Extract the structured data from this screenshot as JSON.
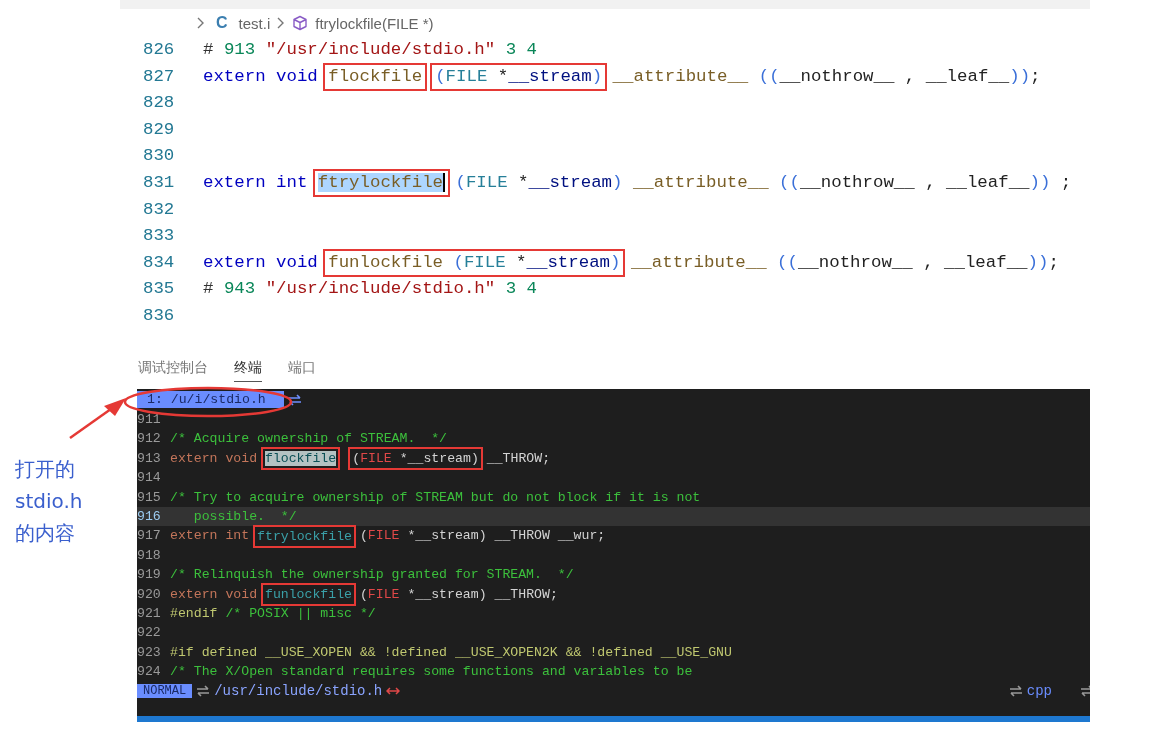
{
  "breadcrumb": {
    "file_badge": "C",
    "file": "test.i",
    "symbol": "ftrylockfile(FILE *)"
  },
  "editor": {
    "lines": [
      {
        "number": "826",
        "tokens": [
          {
            "kind": "preproc",
            "text": "# "
          },
          {
            "kind": "number",
            "text": "913 "
          },
          {
            "kind": "string",
            "text": "\"/usr/include/stdio.h\""
          },
          {
            "kind": "number",
            "text": " 3 4"
          }
        ]
      },
      {
        "number": "827",
        "tokens": [
          {
            "kind": "keyword",
            "text": "extern void "
          },
          {
            "kind": "box",
            "tokens": [
              {
                "kind": "func",
                "text": "flockfile"
              }
            ]
          },
          {
            "kind": "box",
            "tokens": [
              {
                "kind": "paren",
                "text": "("
              },
              {
                "kind": "type",
                "text": "FILE"
              },
              {
                "kind": "plain",
                "text": " *"
              },
              {
                "kind": "param",
                "text": "__stream"
              },
              {
                "kind": "paren",
                "text": ")"
              }
            ]
          },
          {
            "kind": "attr",
            "text": " __attribute__"
          },
          {
            "kind": "paren",
            "text": " (("
          },
          {
            "kind": "plain",
            "text": "__nothrow__ , __leaf__"
          },
          {
            "kind": "paren",
            "text": "))"
          },
          {
            "kind": "plain",
            "text": ";"
          }
        ]
      },
      {
        "number": "828"
      },
      {
        "number": "829"
      },
      {
        "number": "830"
      },
      {
        "number": "831",
        "tokens": [
          {
            "kind": "keyword",
            "text": "extern int "
          },
          {
            "kind": "box",
            "tokens": [
              {
                "kind": "selection",
                "text": "ftrylockfile"
              }
            ]
          },
          {
            "kind": "paren",
            "text": " ("
          },
          {
            "kind": "type",
            "text": "FILE"
          },
          {
            "kind": "plain",
            "text": " *"
          },
          {
            "kind": "param",
            "text": "__stream"
          },
          {
            "kind": "paren",
            "text": ")"
          },
          {
            "kind": "attr",
            "text": " __attribute__"
          },
          {
            "kind": "paren",
            "text": " (("
          },
          {
            "kind": "plain",
            "text": "__nothrow__ , __leaf__"
          },
          {
            "kind": "paren",
            "text": "))"
          },
          {
            "kind": "plain",
            "text": " ;"
          }
        ]
      },
      {
        "number": "832"
      },
      {
        "number": "833"
      },
      {
        "number": "834",
        "tokens": [
          {
            "kind": "keyword",
            "text": "extern void "
          },
          {
            "kind": "box",
            "tokens": [
              {
                "kind": "func",
                "text": "funlockfile"
              },
              {
                "kind": "paren",
                "text": " ("
              },
              {
                "kind": "type",
                "text": "FILE"
              },
              {
                "kind": "plain",
                "text": " *"
              },
              {
                "kind": "param",
                "text": "__stream"
              },
              {
                "kind": "paren",
                "text": ")"
              }
            ]
          },
          {
            "kind": "attr",
            "text": " __attribute__"
          },
          {
            "kind": "paren",
            "text": " (("
          },
          {
            "kind": "plain",
            "text": "__nothrow__ , __leaf__"
          },
          {
            "kind": "paren",
            "text": "))"
          },
          {
            "kind": "plain",
            "text": ";"
          }
        ]
      },
      {
        "number": "835",
        "tokens": [
          {
            "kind": "preproc",
            "text": "# "
          },
          {
            "kind": "number",
            "text": "943 "
          },
          {
            "kind": "string",
            "text": "\"/usr/include/stdio.h\""
          },
          {
            "kind": "number",
            "text": " 3 4"
          }
        ]
      },
      {
        "number": "836"
      }
    ]
  },
  "panel_tabs": [
    {
      "label": "调试控制台",
      "selected": false
    },
    {
      "label": "终端",
      "selected": true
    },
    {
      "label": "端口",
      "selected": false
    }
  ],
  "terminal": {
    "tab": {
      "label": "1: /u/i/stdio.h"
    },
    "lines": [
      {
        "number": "911",
        "current": false
      },
      {
        "number": "912",
        "current": false,
        "tokens": [
          {
            "kind": "comment",
            "text": "/* Acquire ownership of STREAM.  */"
          }
        ]
      },
      {
        "number": "913",
        "current": false,
        "tokens": [
          {
            "kind": "keyword",
            "text": "extern void "
          },
          {
            "kind": "box",
            "tokens": [
              {
                "kind": "match",
                "text": "flockfile"
              }
            ]
          },
          {
            "kind": "box",
            "tokens": [
              {
                "kind": "plain",
                "text": "("
              },
              {
                "kind": "type",
                "text": "FILE"
              },
              {
                "kind": "plain",
                "text": " *__stream)"
              }
            ]
          },
          {
            "kind": "plain",
            "text": " __THROW;"
          }
        ]
      },
      {
        "number": "914",
        "current": false
      },
      {
        "number": "915",
        "current": false,
        "tokens": [
          {
            "kind": "comment",
            "text": "/* Try to acquire ownership of STREAM but do not block if it is not"
          }
        ]
      },
      {
        "number": "916",
        "current": true,
        "tokens": [
          {
            "kind": "comment",
            "text": "   possible.  */"
          }
        ]
      },
      {
        "number": "917",
        "current": false,
        "tokens": [
          {
            "kind": "keyword",
            "text": "extern int "
          },
          {
            "kind": "box",
            "tokens": [
              {
                "kind": "func",
                "text": "ftrylockfile"
              }
            ]
          },
          {
            "kind": "plain",
            "text": " ("
          },
          {
            "kind": "type",
            "text": "FILE"
          },
          {
            "kind": "plain",
            "text": " *__stream) __THROW __wur;"
          }
        ]
      },
      {
        "number": "918",
        "current": false
      },
      {
        "number": "919",
        "current": false,
        "tokens": [
          {
            "kind": "comment",
            "text": "/* Relinquish the ownership granted for STREAM.  */"
          }
        ]
      },
      {
        "number": "920",
        "current": false,
        "tokens": [
          {
            "kind": "keyword",
            "text": "extern void "
          },
          {
            "kind": "box",
            "tokens": [
              {
                "kind": "func",
                "text": "funlockfile"
              }
            ]
          },
          {
            "kind": "plain",
            "text": " ("
          },
          {
            "kind": "type",
            "text": "FILE"
          },
          {
            "kind": "plain",
            "text": " *__stream) __THROW;"
          }
        ]
      },
      {
        "number": "921",
        "current": false,
        "tokens": [
          {
            "kind": "preproc",
            "text": "#endif "
          },
          {
            "kind": "comment",
            "text": "/* POSIX || misc */"
          }
        ]
      },
      {
        "number": "922",
        "current": false
      },
      {
        "number": "923",
        "current": false,
        "tokens": [
          {
            "kind": "preproc",
            "text": "#if defined __USE_XOPEN && !defined __USE_XOPEN2K && !defined __USE_GNU"
          }
        ]
      },
      {
        "number": "924",
        "current": false,
        "tokens": [
          {
            "kind": "comment",
            "text": "/* The X/Open standard requires some functions and variables to be"
          }
        ]
      }
    ],
    "status": {
      "mode": "NORMAL",
      "path": "/usr/include/stdio.h",
      "filetype": "cpp"
    }
  },
  "annotation": {
    "text": "打开的\nstdio.h\n的内容"
  }
}
